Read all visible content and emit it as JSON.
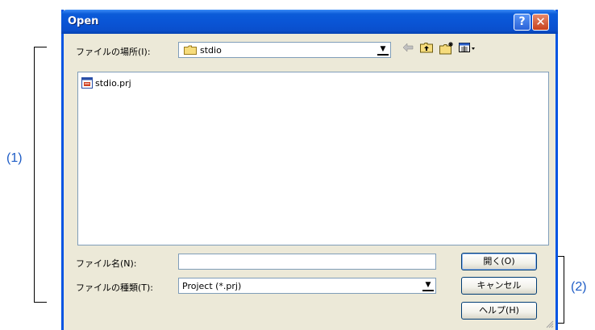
{
  "callouts": {
    "left": "(1)",
    "right": "(2)"
  },
  "dialog": {
    "title": "Open",
    "help_glyph": "?",
    "close_glyph": "✕"
  },
  "location": {
    "label": "ファイルの場所(I):",
    "value": "stdio"
  },
  "toolbar": {
    "back_icon": "back-arrow-icon",
    "up_icon": "up-folder-icon",
    "new_folder_icon": "new-folder-icon",
    "view_menu_icon": "view-menu-icon"
  },
  "files": [
    {
      "name": "stdio.prj",
      "icon": "project-file-icon"
    }
  ],
  "filename": {
    "label": "ファイル名(N):",
    "value": ""
  },
  "filetype": {
    "label": "ファイルの種類(T):",
    "value": "Project (*.prj)"
  },
  "buttons": {
    "open": "開く(O)",
    "cancel": "キャンセル",
    "help": "ヘルプ(H)"
  },
  "colors": {
    "titlebar": "#0a55d6",
    "callout_text": "#1e5cc6",
    "dialog_bg": "#ece9d8"
  }
}
